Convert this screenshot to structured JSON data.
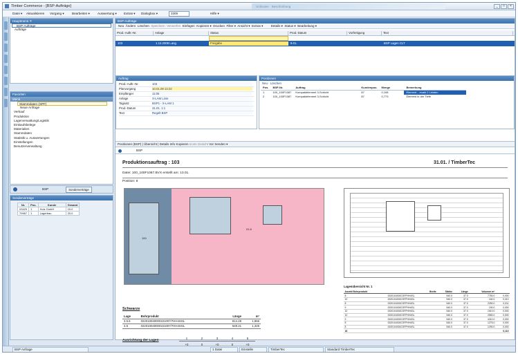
{
  "window": {
    "title": "Timber Commerce - [BSP-Aufträge]",
    "center_text": "Unknown · Beschreibung",
    "buttons": [
      "_",
      "□",
      "×"
    ]
  },
  "menu": {
    "items": [
      "Datei ▾",
      "Aktualisieren",
      "Vorgang ▾",
      "Bearbeiten ▾",
      "Auswertung ▾",
      "Extras ▾",
      "Dialogbox ▾"
    ],
    "doc_field": "3309",
    "help": "Hilfe ▾"
  },
  "nav_top": {
    "header": "Hauptmenü ✕",
    "items": [
      "BSP-Aufträge",
      "Aufträge"
    ]
  },
  "nav_tree": {
    "header": "Favoriten",
    "section": "Menü",
    "items": [
      "Stammdaten (SPF)",
      "Neue Anfrage",
      "Verkauf",
      "Produktion",
      "Lagerverwaltung/Logistik",
      "Einkaufsbelege",
      "Materialien",
      "Stammdaten",
      "Statistik u. Auswertungen",
      "Einstellungen",
      "Benutzerverwaltung"
    ]
  },
  "nav_tabs": {
    "tab": "BSP",
    "button": "Sonderverträge"
  },
  "nav_table": {
    "header": "Sonderverträge",
    "columns": [
      "Nr.",
      "Pos.",
      "Kunde",
      "Gesamt"
    ],
    "rows": [
      [
        "03429",
        "1",
        "Holz GmbH",
        "15.0"
      ],
      [
        "79967",
        "1",
        "Lagerbau",
        "20.0"
      ]
    ]
  },
  "main": {
    "header": "BSP-Aufträge",
    "toolbar": [
      "Neu",
      "Ändern",
      "Löschen",
      "Speichern",
      "Verwerfen",
      "Einfügen",
      "Kopieren ▾",
      "Drucken",
      "Filter ▾",
      "Ansicht ▾",
      "Extras ▾",
      "Details ▾",
      "Status ▾",
      "Bearbeitung ▾"
    ],
    "grid_columns": [
      "Prod.-Auftr.-Nr.",
      "Anlage",
      "Status",
      "Prod.-Datum",
      "Vorfertigung",
      "Text"
    ],
    "grid_row": [
      "103",
      "1.12.2008 Lang",
      "Freigabe",
      "9.01.",
      "",
      "BSP Lagen CLT"
    ],
    "grid_editing": [
      "",
      "",
      "Freigabe",
      "",
      "",
      ""
    ]
  },
  "detail": {
    "header": "Auftrag",
    "fields": [
      [
        "Prod.-Auftr.-Nr.",
        "103"
      ],
      [
        "Planvorgang",
        "10.01.08 13:22"
      ],
      [
        "Empfänger",
        "11:05"
      ],
      [
        "Anlage",
        "X-LAM Linie"
      ],
      [
        "Tagsatz",
        "BSP1 - X-LAM 1"
      ],
      [
        "Prod.-Datum",
        "31.01.   1:1"
      ],
      [
        "Text",
        "Regelt BSP"
      ]
    ]
  },
  "subs": {
    "header": "Positionen",
    "tabs": "Neu · Löschen",
    "columns": [
      "Pos.",
      "BSP-Nr.",
      "Auftrag",
      "Kundenpos.",
      "Menge",
      "Bemerkung"
    ],
    "rows": [
      [
        "1",
        "100_100F1087",
        "Kompaktelement 3-Schicht",
        "87",
        "0,108",
        "Element ...exakt 2 Leisten"
      ],
      [
        "2",
        "100_100F1087",
        "Kompaktelement 3-Schicht",
        "87",
        "0,773",
        "Element in der Tiefe"
      ]
    ]
  },
  "position_tabs": [
    "Positionen (BSP)",
    "Übersicht",
    "Details",
    "Info",
    "Kopieren",
    "Icons",
    "Gesicht",
    "Vor",
    "Senden ▾"
  ],
  "doc_tab": "BSP",
  "doc": {
    "title": "Produktionsauftrag : 103",
    "right_title": "31.01. / TimberTec",
    "subtitle": "Datei: 100_100F1087.BVX   erstellt am:  13.01.",
    "position": "Position: 8",
    "plate_label": "100",
    "plate_label2": "01.8",
    "boards_header": "Schwarze",
    "boards_cols": [
      "Lage",
      "Bohrprodukt",
      "Länge",
      "m²"
    ],
    "boards_rows": [
      [
        "3.5.6",
        "022010040000221007/7HH4SGL",
        "814.28",
        "1,866"
      ],
      [
        "4.5",
        "022010040000221007/7HH4SGL",
        "549.21",
        "1,325"
      ]
    ],
    "orientation_label": "Ausrichtung der Lagen",
    "orientation_nums": [
      "1",
      "2",
      "3",
      "4",
      "5"
    ],
    "orientation_vals": [
      "+0",
      "0",
      "+0",
      "0",
      "+0"
    ],
    "right_table_header": "Lagenübersicht Nr. 1",
    "right_cols": [
      "Anzahl Bohrprodukt",
      "Breite",
      "Stärke",
      "Länge",
      "Volumen m³"
    ],
    "right_rows": [
      [
        "8",
        "0020104000CSFPHH4SL",
        "540.0",
        "37.0",
        "7750.0",
        "0,000"
      ],
      [
        "10",
        "0020104000CSFPHH4SL",
        "540.0",
        "37.0",
        "160.0",
        "0,010"
      ],
      [
        "8",
        "0020104000CSFPHH4SL",
        "540.0",
        "37.0",
        "2250.0",
        "0,011"
      ],
      [
        "9",
        "0020104000CSFPHH4SL",
        "540.0",
        "37.0",
        "190.0",
        "0,000"
      ],
      [
        "10",
        "0020104000CSFPHH4SL",
        "540.0",
        "37.0",
        "1510.0",
        "0,000"
      ],
      [
        "10",
        "0020104000CSFPHH4SL",
        "540.0",
        "37.0",
        "2550.0",
        "0,000"
      ],
      [
        "9",
        "0020104000CSFPHH4SL",
        "540.0",
        "37.0",
        "4310.0",
        "0,000"
      ],
      [
        "8",
        "0020104000CSFPHH4SL",
        "540.0",
        "37.0",
        "1275.0",
        "0,000"
      ],
      [
        "8",
        "0020104000CSFPHH4SL",
        "540.0",
        "37.0",
        "1290.0",
        "0,000"
      ],
      [
        "18",
        "",
        "",
        "",
        "",
        "0,110"
      ]
    ]
  },
  "statusbar": [
    "BSP Anfrage",
    "1 Datei",
    "Einstelle",
    "TimberTec",
    "Standard TimberTec"
  ]
}
